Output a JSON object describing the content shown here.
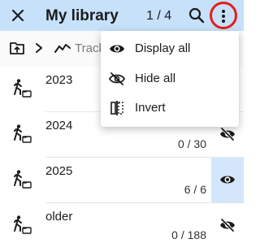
{
  "header": {
    "title": "My library",
    "page_indicator": "1 / 4"
  },
  "breadcrumb": {
    "current": "Track"
  },
  "rows": [
    {
      "name": "2023",
      "count": ""
    },
    {
      "name": "2024",
      "count": "0 / 30"
    },
    {
      "name": "2025",
      "count": "6 / 6"
    },
    {
      "name": "older",
      "count": "0 / 188"
    }
  ],
  "menu": {
    "display_all": "Display all",
    "hide_all": "Hide all",
    "invert": "Invert"
  },
  "icons": {
    "close": "close-icon",
    "search": "search-icon",
    "overflow": "more-vert-icon",
    "folder_up": "folder-up-icon",
    "chevron": "chevron-right-icon",
    "track": "track-icon",
    "hiker": "hiking-folder-icon",
    "eye": "eye-icon",
    "eye_off": "eye-off-icon",
    "invert": "invert-icon"
  },
  "colors": {
    "topbar": "#c7e1fb",
    "highlight_circle": "#e51d1d",
    "selected_toggle": "#d3e6fb"
  }
}
